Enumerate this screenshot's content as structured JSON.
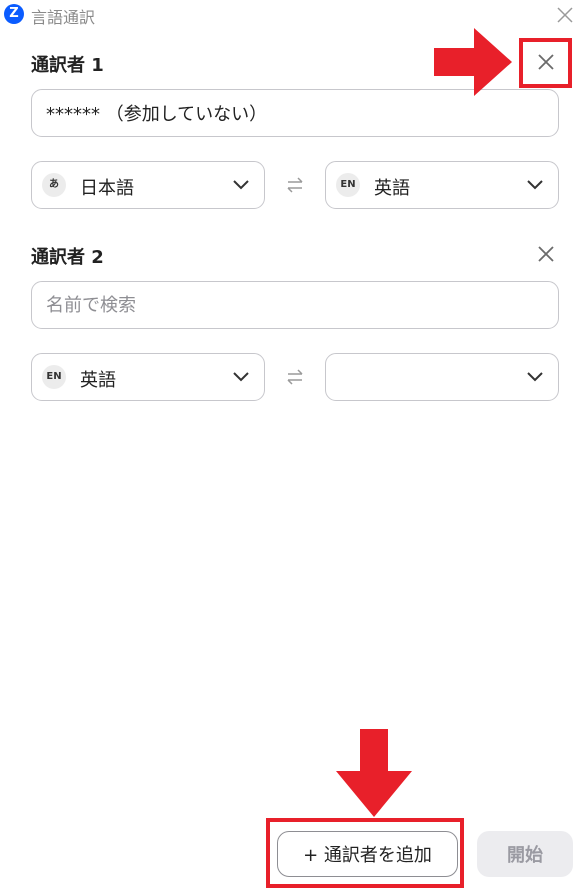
{
  "window": {
    "title": "言語通訳",
    "logo_letter": "Z"
  },
  "interpreters": [
    {
      "title": "通訳者 1",
      "name_value": "****** （参加していない）",
      "from_lang": {
        "badge": "あ",
        "label": "日本語"
      },
      "to_lang": {
        "badge": "EN",
        "label": "英語"
      }
    },
    {
      "title": "通訳者 2",
      "name_placeholder": "名前で検索",
      "from_lang": {
        "badge": "EN",
        "label": "英語"
      },
      "to_lang": {
        "badge": "",
        "label": ""
      }
    }
  ],
  "footer": {
    "add_label": "+ 通訳者を追加",
    "start_label": "開始"
  },
  "colors": {
    "highlight": "#e8202a",
    "accent": "#0b5cff",
    "border": "#c7c7cc"
  },
  "icons": [
    "close-icon",
    "swap-arrows-icon",
    "chevron-down-icon",
    "arrow-right-icon",
    "arrow-down-icon"
  ]
}
